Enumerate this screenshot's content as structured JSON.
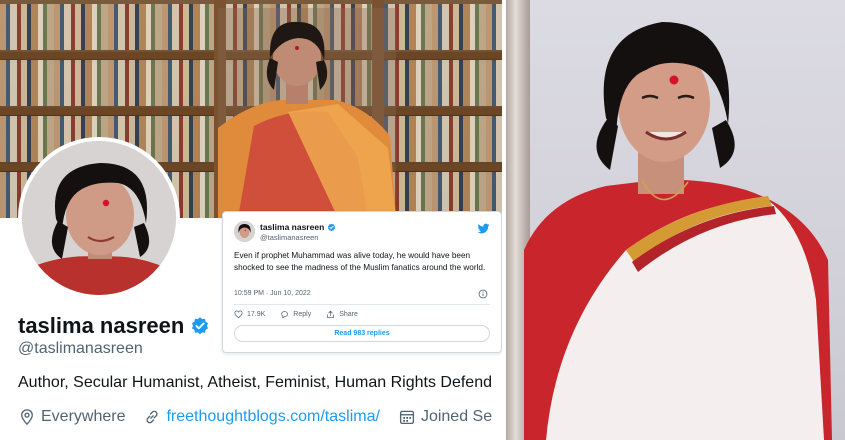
{
  "profile": {
    "name": "taslima nasreen",
    "handle": "@taslimanasreen",
    "bio": "Author, Secular Humanist, Atheist, Feminist, Human Rights Defend",
    "location": "Everywhere",
    "website": "freethoughtblogs.com/taslima/",
    "joined": "Joined Se"
  },
  "tweet": {
    "name": "taslima nasreen",
    "handle": "@taslimanasreen",
    "text": "Even if prophet Muhammad was alive today, he would have been shocked to see the madness of the Muslim fanatics around the world.",
    "timestamp": "10:59 PM · Jun 10, 2022",
    "likes": "17.9K",
    "reply_label": "Reply",
    "share_label": "Share",
    "replies_button": "Read 983 replies"
  },
  "colors": {
    "accent": "#1d9bf0",
    "text_primary": "#0f1419",
    "text_secondary": "#536471",
    "bindi": "#d6122b"
  },
  "icons": {
    "verified": "verified-badge-icon",
    "location": "location-pin-icon",
    "link": "link-icon",
    "calendar": "calendar-icon",
    "twitter": "twitter-bird-icon",
    "like": "heart-icon",
    "reply": "reply-bubble-icon",
    "share": "share-icon",
    "info": "info-icon"
  }
}
